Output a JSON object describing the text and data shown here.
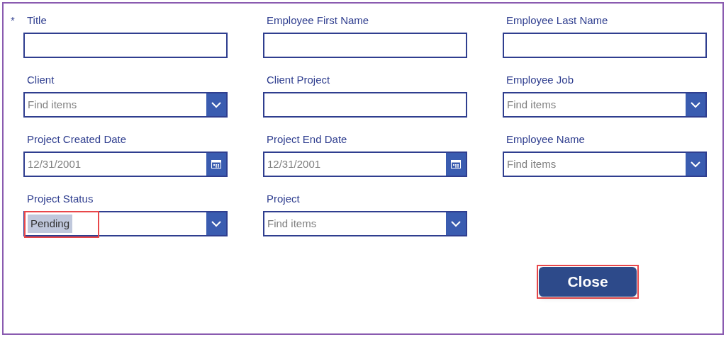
{
  "fields": [
    {
      "label": "Title",
      "kind": "text",
      "required": true
    },
    {
      "label": "Employee First Name",
      "kind": "text",
      "required": false
    },
    {
      "label": "Employee Last Name",
      "kind": "text",
      "required": false
    },
    {
      "label": "Client",
      "kind": "combo",
      "required": false,
      "placeholder": "Find items"
    },
    {
      "label": "Client Project",
      "kind": "text",
      "required": false
    },
    {
      "label": "Employee Job",
      "kind": "combo",
      "required": false,
      "placeholder": "Find items"
    },
    {
      "label": "Project Created Date",
      "kind": "date",
      "required": false,
      "placeholder": "12/31/2001"
    },
    {
      "label": "Project End Date",
      "kind": "date",
      "required": false,
      "placeholder": "12/31/2001"
    },
    {
      "label": "Employee Name",
      "kind": "combo",
      "required": false,
      "placeholder": "Find items"
    },
    {
      "label": "Project Status",
      "kind": "combo",
      "required": false,
      "value": "Pending",
      "highlighted": true
    },
    {
      "label": "Project",
      "kind": "combo",
      "required": false,
      "placeholder": "Find items"
    }
  ],
  "required_mark": "*",
  "close_button": {
    "label": "Close",
    "highlighted": true
  }
}
